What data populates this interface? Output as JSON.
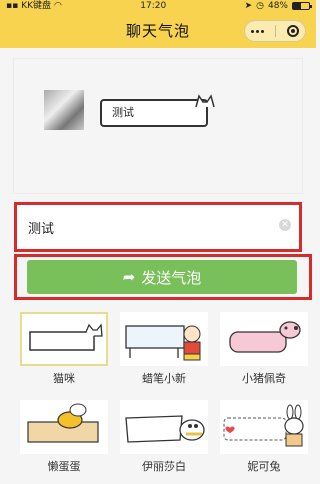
{
  "status": {
    "carrier": "KK键盘",
    "time": "17:20",
    "battery": "48%",
    "battery_level": 0.48
  },
  "nav": {
    "title": "聊天气泡"
  },
  "preview": {
    "bubble_text": "测试"
  },
  "input": {
    "value": "测试"
  },
  "send_button": {
    "label": "发送气泡"
  },
  "styles": [
    {
      "name": "猫咪",
      "selected": true
    },
    {
      "name": "蜡笔小新",
      "selected": false
    },
    {
      "name": "小猪佩奇",
      "selected": false
    },
    {
      "name": "懒蛋蛋",
      "selected": false
    },
    {
      "name": "伊丽莎白",
      "selected": false
    },
    {
      "name": "妮可兔",
      "selected": false
    }
  ],
  "colors": {
    "header": "#f7d34f",
    "button": "#79c05b",
    "highlight": "#d62b2b"
  }
}
